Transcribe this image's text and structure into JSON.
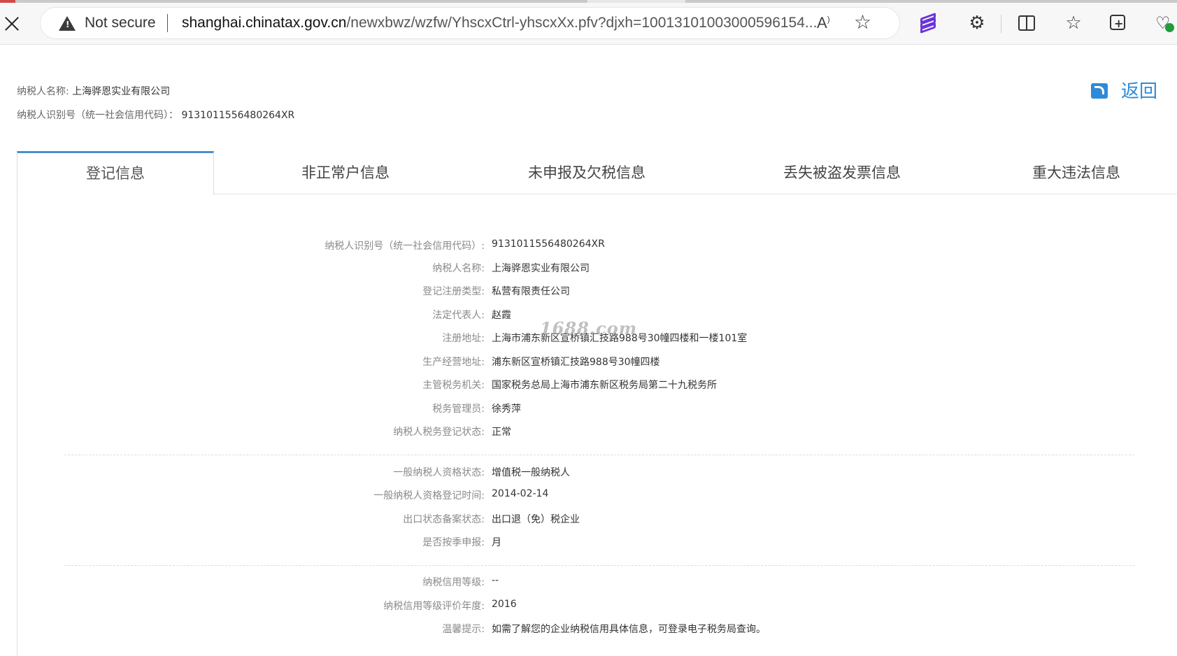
{
  "browser": {
    "security_label": "Not secure",
    "url_host": "shanghai.chinatax.gov.cn",
    "url_path": "/newxbwz/wzfw/YhscxCtrl-yhscxXx.pfv?djxh=10013101003000596154...",
    "read_aloud_label": "Ả"
  },
  "header": {
    "name_label": "纳税人名称:",
    "name_value": "上海骅恩实业有限公司",
    "id_label": "纳税人识别号（统一社会信用代码）：",
    "id_value": "9131011556480264XR",
    "back_label": "返回"
  },
  "tabs": [
    {
      "label": "登记信息",
      "active": true
    },
    {
      "label": "非正常户信息",
      "active": false
    },
    {
      "label": "未申报及欠税信息",
      "active": false
    },
    {
      "label": "丢失被盗发票信息",
      "active": false
    },
    {
      "label": "重大违法信息",
      "active": false
    }
  ],
  "details": {
    "group1": [
      {
        "label": "纳税人识别号（统一社会信用代码）:",
        "value": "9131011556480264XR"
      },
      {
        "label": "纳税人名称:",
        "value": "上海骅恩实业有限公司"
      },
      {
        "label": "登记注册类型:",
        "value": "私营有限责任公司"
      },
      {
        "label": "法定代表人:",
        "value": "赵霞"
      },
      {
        "label": "注册地址:",
        "value": "上海市浦东新区宣桥镇汇技路988号30幢四楼和一楼101室"
      },
      {
        "label": "生产经营地址:",
        "value": "浦东新区宣桥镇汇技路988号30幢四楼"
      },
      {
        "label": "主管税务机关:",
        "value": "国家税务总局上海市浦东新区税务局第二十九税务所"
      },
      {
        "label": "税务管理员:",
        "value": "徐秀萍"
      },
      {
        "label": "纳税人税务登记状态:",
        "value": "正常"
      }
    ],
    "group2": [
      {
        "label": "一般纳税人资格状态:",
        "value": "增值税一般纳税人"
      },
      {
        "label": "一般纳税人资格登记时间:",
        "value": "2014-02-14"
      },
      {
        "label": "出口状态备案状态:",
        "value": "出口退（免）税企业"
      },
      {
        "label": "是否按季申报:",
        "value": "月"
      }
    ],
    "group3": [
      {
        "label": "纳税信用等级:",
        "value": "--"
      },
      {
        "label": "纳税信用等级评价年度:",
        "value": "2016"
      },
      {
        "label": "温馨提示:",
        "value": "如需了解您的企业纳税信用具体信息，可登录电子税务局查询。"
      }
    ]
  },
  "watermark": "1688.com"
}
